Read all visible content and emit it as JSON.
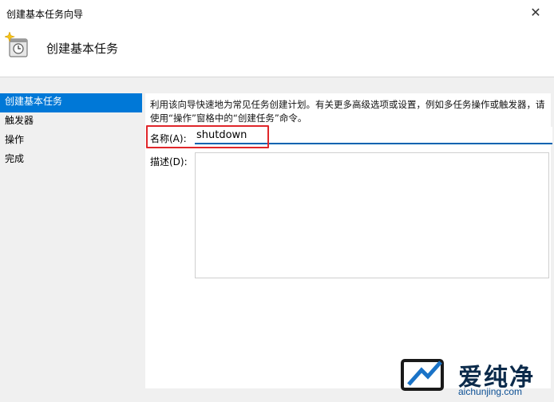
{
  "window": {
    "title": "创建基本任务向导",
    "close_glyph": "✕"
  },
  "header": {
    "title": "创建基本任务",
    "icon": "calendar-clock-icon"
  },
  "sidebar": {
    "items": [
      {
        "label": "创建基本任务",
        "active": true
      },
      {
        "label": "触发器",
        "active": false
      },
      {
        "label": "操作",
        "active": false
      },
      {
        "label": "完成",
        "active": false
      }
    ]
  },
  "main": {
    "intro": "利用该向导快速地为常见任务创建计划。有关更多高级选项或设置，例如多任务操作或触发器，请使用“操作”窗格中的“创建任务”命令。",
    "name_label": "名称(A):",
    "name_value": "shutdown",
    "description_label": "描述(D):",
    "description_value": ""
  },
  "watermark": {
    "brand": "爱纯净",
    "url": "aichunjing.com"
  },
  "colors": {
    "accent": "#0078d7",
    "highlight": "#e0262a"
  }
}
